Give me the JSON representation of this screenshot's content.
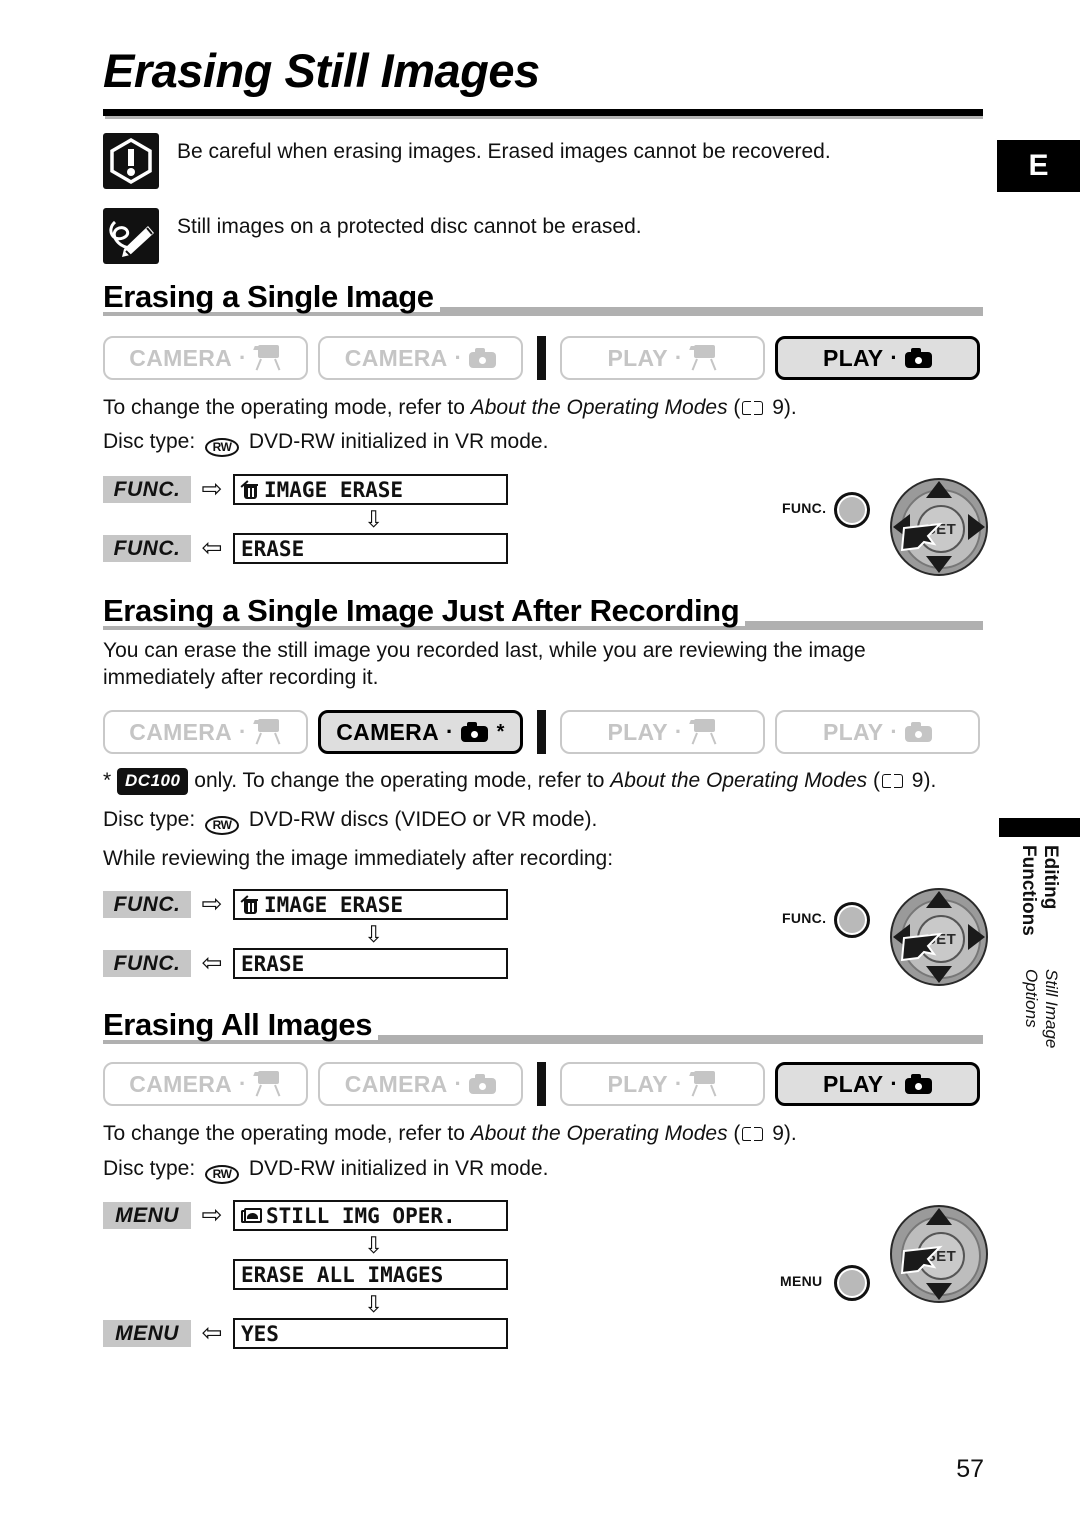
{
  "page": {
    "title": "Erasing Still Images",
    "number": "57",
    "lang_tab": "E",
    "side_tab": {
      "primary": "Editing Functions",
      "secondary": "Still Image Options"
    }
  },
  "notices": [
    {
      "icon": "warning-icon",
      "text": "Be careful when erasing images. Erased images cannot be recovered."
    },
    {
      "icon": "note-pencil-icon",
      "text": "Still images on a protected disc cannot be erased."
    }
  ],
  "sections": [
    {
      "id": "erasing-a-single-image",
      "heading": "Erasing a Single Image",
      "intro": "",
      "modes": [
        {
          "label": "CAMERA",
          "icon": "camcorder-icon",
          "active": false,
          "star": false
        },
        {
          "label": "CAMERA",
          "icon": "photo-camera-icon",
          "active": false,
          "star": false
        },
        {
          "label": "PLAY",
          "icon": "camcorder-icon",
          "active": false,
          "star": false
        },
        {
          "label": "PLAY",
          "icon": "photo-camera-icon",
          "active": true,
          "star": false
        }
      ],
      "notes": [
        {
          "pre": "To change the operating mode, refer to ",
          "em": "About the Operating Modes",
          "post_icon": "book-icon",
          "post": " 9)."
        },
        {
          "pre": "Disc type: ",
          "disc": "RW",
          "post": " DVD-RW initialized in VR mode."
        }
      ],
      "flow": [
        {
          "key": "FUNC.",
          "arrow": "right",
          "icon": "trash-icon",
          "item": "IMAGE ERASE"
        },
        {
          "key": "FUNC.",
          "arrow": "left",
          "icon": "",
          "item": "ERASE"
        }
      ],
      "control": {
        "button": "FUNC.",
        "center": "SET",
        "directions": [
          "up",
          "down",
          "left",
          "right"
        ]
      }
    },
    {
      "id": "erasing-a-single-image-just-after-recording",
      "heading": "Erasing a Single Image Just After Recording",
      "intro": "You can erase the still image you recorded last, while you are reviewing the image immediately after recording it.",
      "modes": [
        {
          "label": "CAMERA",
          "icon": "camcorder-icon",
          "active": false,
          "star": false
        },
        {
          "label": "CAMERA",
          "icon": "photo-camera-icon",
          "active": true,
          "star": true
        },
        {
          "label": "PLAY",
          "icon": "camcorder-icon",
          "active": false,
          "star": false
        },
        {
          "label": "PLAY",
          "icon": "photo-camera-icon",
          "active": false,
          "star": false
        }
      ],
      "notes": [
        {
          "pre": "* ",
          "model": "DC100",
          "mid": " only. To change the operating mode, refer to ",
          "em": "About the Operating Modes",
          "post_icon": "book-icon",
          "post": " 9)."
        },
        {
          "pre": "Disc type: ",
          "disc": "RW",
          "post": " DVD-RW discs (VIDEO or VR mode)."
        },
        {
          "pre": "While reviewing the image immediately after recording:"
        }
      ],
      "flow": [
        {
          "key": "FUNC.",
          "arrow": "right",
          "icon": "trash-icon",
          "item": "IMAGE ERASE"
        },
        {
          "key": "FUNC.",
          "arrow": "left",
          "icon": "",
          "item": "ERASE"
        }
      ],
      "control": {
        "button": "FUNC.",
        "center": "SET",
        "directions": [
          "up",
          "down",
          "left",
          "right"
        ]
      }
    },
    {
      "id": "erasing-all-images",
      "heading": "Erasing All Images",
      "intro": "",
      "modes": [
        {
          "label": "CAMERA",
          "icon": "camcorder-icon",
          "active": false,
          "star": false
        },
        {
          "label": "CAMERA",
          "icon": "photo-camera-icon",
          "active": false,
          "star": false
        },
        {
          "label": "PLAY",
          "icon": "camcorder-icon",
          "active": false,
          "star": false
        },
        {
          "label": "PLAY",
          "icon": "photo-camera-icon",
          "active": true,
          "star": false
        }
      ],
      "notes": [
        {
          "pre": "To change the operating mode, refer to ",
          "em": "About the Operating Modes",
          "post_icon": "book-icon",
          "post": " 9)."
        },
        {
          "pre": "Disc type: ",
          "disc": "RW",
          "post": " DVD-RW initialized in VR mode."
        }
      ],
      "flow": [
        {
          "key": "MENU",
          "arrow": "right",
          "icon": "folder-photo-icon",
          "item": "STILL IMG OPER."
        },
        {
          "key": "",
          "arrow": "none",
          "icon": "",
          "item": "ERASE ALL IMAGES"
        },
        {
          "key": "MENU",
          "arrow": "left",
          "icon": "",
          "item": "YES"
        }
      ],
      "control": {
        "button": "MENU",
        "center": "SET",
        "directions": [
          "up",
          "down"
        ]
      }
    }
  ],
  "glyphs": {
    "arrow_right": "⇨",
    "arrow_left": "⇦",
    "arrow_down": "⇩",
    "dot_sep": "·",
    "star": "*"
  },
  "colors": {
    "key_bg": "#c6c6c6",
    "badge_off_text": "#c5c5c5",
    "badge_on_bg": "#dedede",
    "heading_bar": "#b0b0b0",
    "ink": "#111111"
  }
}
